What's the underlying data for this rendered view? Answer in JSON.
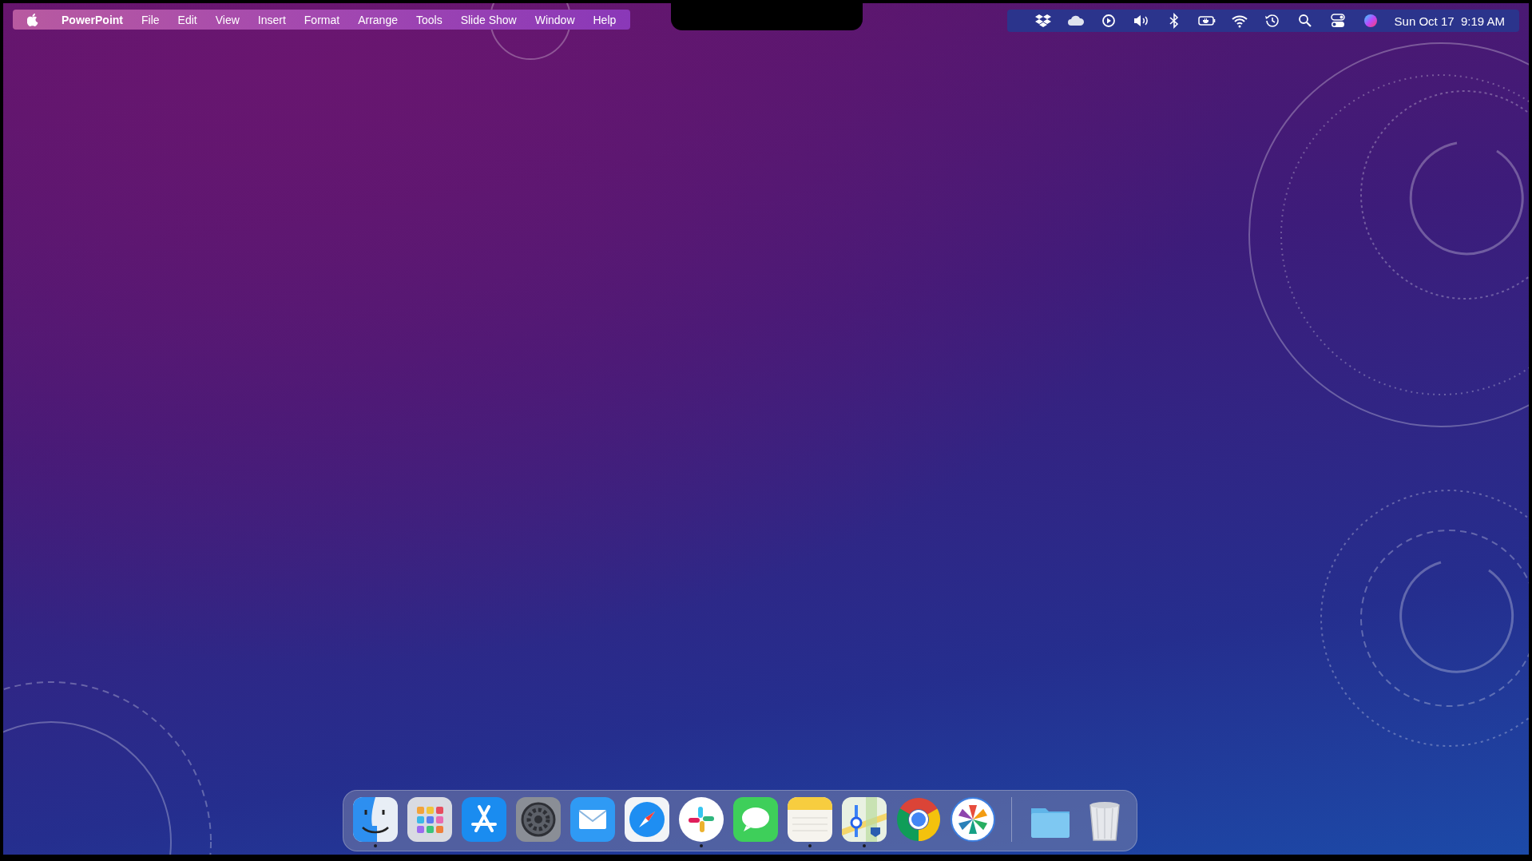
{
  "menu_bar": {
    "items": [
      {
        "label": "PowerPoint",
        "kind": "app"
      },
      {
        "label": "File",
        "kind": "menu"
      },
      {
        "label": "Edit",
        "kind": "menu"
      },
      {
        "label": "View",
        "kind": "menu"
      },
      {
        "label": "Insert",
        "kind": "menu"
      },
      {
        "label": "Format",
        "kind": "menu"
      },
      {
        "label": "Arrange",
        "kind": "menu"
      },
      {
        "label": "Tools",
        "kind": "menu"
      },
      {
        "label": "Slide Show",
        "kind": "menu"
      },
      {
        "label": "Window",
        "kind": "menu"
      },
      {
        "label": "Help",
        "kind": "menu"
      }
    ],
    "clock": "Sun Oct 17  9:19 AM"
  },
  "dock": {
    "apps": [
      {
        "running": true
      },
      {
        "running": false
      },
      {
        "running": false
      },
      {
        "running": false
      },
      {
        "running": false
      },
      {
        "running": false
      },
      {
        "running": true
      },
      {
        "running": false
      },
      {
        "running": true
      },
      {
        "running": true
      },
      {
        "running": false
      },
      {
        "running": false
      }
    ],
    "others": [
      {
        "running": false
      },
      {
        "running": false
      }
    ]
  }
}
